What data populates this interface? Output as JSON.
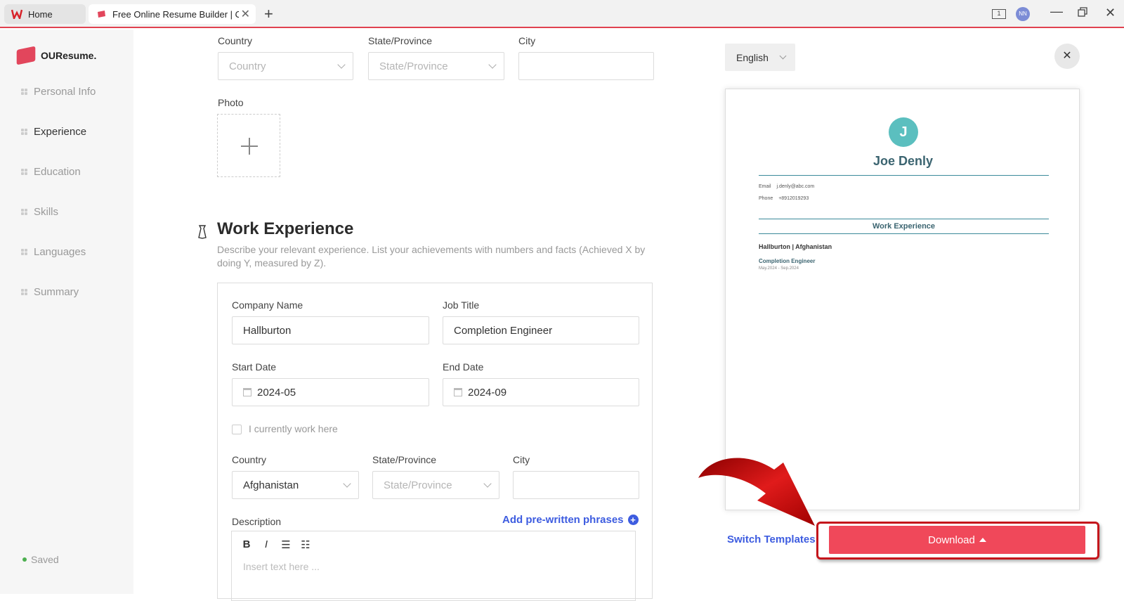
{
  "browser": {
    "tabs": [
      {
        "label": "Home"
      },
      {
        "label": "Free Online Resume Builder | OURe"
      }
    ],
    "new_tab": "+",
    "reader_badge": "1",
    "profile_initials": "NN"
  },
  "sidebar": {
    "logo": "OUResume.",
    "items": [
      {
        "label": "Personal Info"
      },
      {
        "label": "Experience"
      },
      {
        "label": "Education"
      },
      {
        "label": "Skills"
      },
      {
        "label": "Languages"
      },
      {
        "label": "Summary"
      }
    ],
    "status": "Saved"
  },
  "personal": {
    "country_label": "Country",
    "country_placeholder": "Country",
    "state_label": "State/Province",
    "state_placeholder": "State/Province",
    "city_label": "City",
    "photo_label": "Photo"
  },
  "work": {
    "title": "Work Experience",
    "description": "Describe your relevant experience. List your achievements with numbers and facts (Achieved X by doing Y, measured by Z).",
    "company_label": "Company Name",
    "company_value": "Hallburton",
    "job_label": "Job Title",
    "job_value": "Completion Engineer",
    "start_label": "Start Date",
    "start_value": "2024-05",
    "end_label": "End Date",
    "end_value": "2024-09",
    "current_label": "I currently work here",
    "country_label": "Country",
    "country_value": "Afghanistan",
    "state_label": "State/Province",
    "state_placeholder": "State/Province",
    "city_label": "City",
    "desc_label": "Description",
    "phrases_link": "Add pre-written phrases",
    "editor_toolbar": [
      "B",
      "I",
      "☰",
      "☷"
    ],
    "editor_placeholder": "Insert text here ..."
  },
  "preview": {
    "language": "English",
    "close": "✕",
    "avatar_letter": "J",
    "name": "Joe  Denly",
    "email_label": "Email",
    "email_value": "j.denly@abc.com",
    "phone_label": "Phone",
    "phone_value": "+8912019293",
    "section": "Work Experience",
    "company_line": "Hallburton   |   Afghanistan",
    "job": "Completion Engineer",
    "dates": "May.2024 - Sep.2024",
    "switch_templates": "Switch Templates",
    "download": "Download"
  },
  "colors": {
    "accent": "#f0485a",
    "link": "#3d5ce0",
    "highlight": "#c4161c",
    "preview_teal": "#3b6470"
  }
}
